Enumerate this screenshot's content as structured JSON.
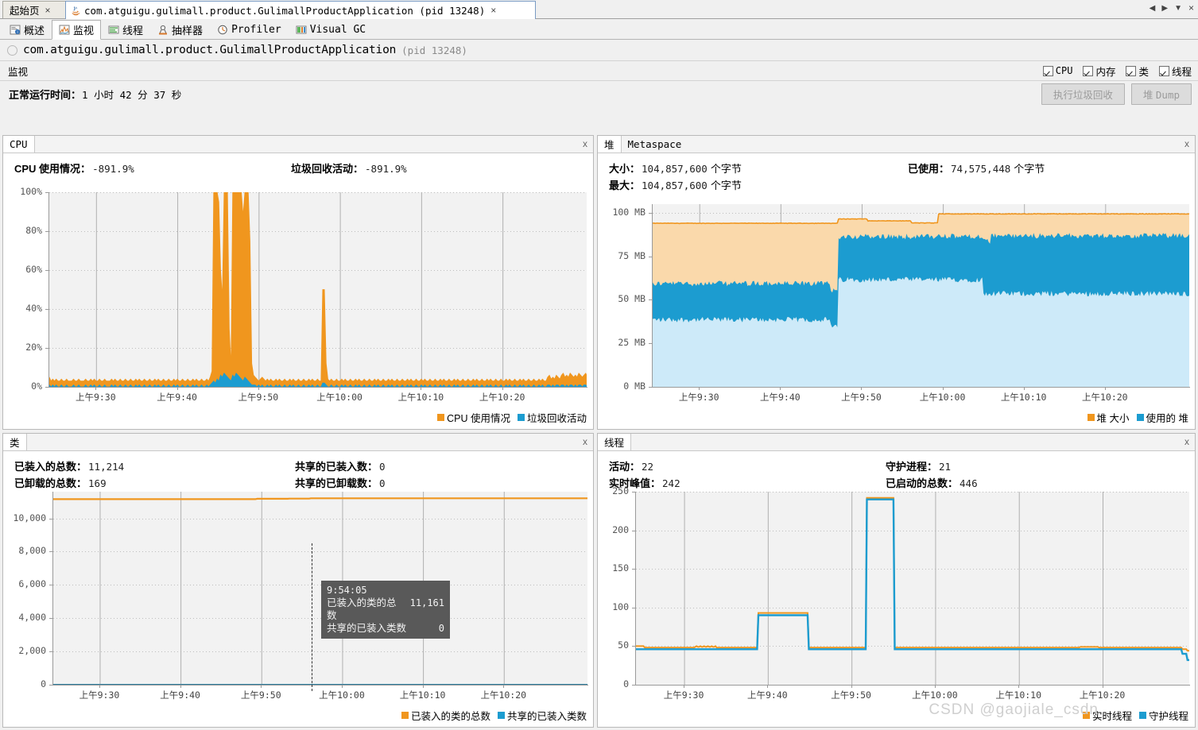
{
  "window": {
    "tabs": [
      {
        "label": "起始页",
        "icon": "none",
        "active": false,
        "close": "×"
      },
      {
        "label": "com.atguigu.gulimall.product.GulimallProductApplication (pid 13248)",
        "icon": "java-icon",
        "active": true,
        "close": "×"
      }
    ],
    "nav": {
      "prev": "◀",
      "next": "▶",
      "down": "▼",
      "close": "×"
    }
  },
  "subtabs": [
    {
      "label": "概述",
      "icon": "overview-icon",
      "active": false
    },
    {
      "label": "监视",
      "icon": "monitor-icon",
      "active": true
    },
    {
      "label": "线程",
      "icon": "threads-icon",
      "active": false
    },
    {
      "label": "抽样器",
      "icon": "sampler-icon",
      "active": false
    },
    {
      "label": "Profiler",
      "icon": "profiler-icon",
      "active": false
    },
    {
      "label": "Visual GC",
      "icon": "visualgc-icon",
      "active": false
    }
  ],
  "app_header": {
    "title": "com.atguigu.gulimall.product.GulimallProductApplication",
    "pid": "(pid 13248)"
  },
  "monitor_bar": {
    "label": "监视",
    "checkboxes": [
      {
        "label": "CPU",
        "checked": true
      },
      {
        "label": "内存",
        "checked": true
      },
      {
        "label": "类",
        "checked": true
      },
      {
        "label": "线程",
        "checked": true
      }
    ]
  },
  "uptime": {
    "label": "正常运行时间：",
    "value": "1 小时 42 分 37 秒"
  },
  "buttons": {
    "gc": "执行垃圾回收",
    "heap_dump_prefix": "堆 ",
    "heap_dump_mono": "Dump"
  },
  "panels": {
    "cpu": {
      "title": "CPU",
      "close": "x",
      "stats": [
        {
          "key": "CPU 使用情况：",
          "value": "-891.9%"
        },
        {
          "key": "垃圾回收活动：",
          "value": "-891.9%"
        }
      ]
    },
    "heap": {
      "tabs": [
        "堆",
        "Metaspace"
      ],
      "selected_tab": "堆",
      "close": "x",
      "stats": [
        {
          "key": "大小：",
          "value": "104,857,600",
          "unit": "个字节"
        },
        {
          "key": "最大：",
          "value": "104,857,600",
          "unit": "个字节"
        },
        {
          "key": "已使用：",
          "value": "74,575,448",
          "unit": "个字节"
        }
      ]
    },
    "classes": {
      "title": "类",
      "close": "x",
      "stats": [
        {
          "key": "已装入的总数：",
          "value": "11,214"
        },
        {
          "key": "已卸载的总数：",
          "value": "169"
        },
        {
          "key": "共享的已装入数：",
          "value": "0"
        },
        {
          "key": "共享的已卸载数：",
          "value": "0"
        }
      ],
      "tooltip": {
        "time": "9:54:05",
        "rows": [
          {
            "label": "已装入的类的总数",
            "value": "11,161"
          },
          {
            "label": "共享的已装入类数",
            "value": "0"
          }
        ]
      }
    },
    "threads": {
      "title": "线程",
      "close": "x",
      "stats": [
        {
          "key": "活动：",
          "value": "22"
        },
        {
          "key": "实时峰值：",
          "value": "242"
        },
        {
          "key": "守护进程：",
          "value": "21"
        },
        {
          "key": "已启动的总数：",
          "value": "446"
        }
      ]
    }
  },
  "watermark": "CSDN @gaojiale_csdn",
  "colors": {
    "orange": "#f0961e",
    "orange_fill": "#fad9ab",
    "blue": "#1c9cd0",
    "blue_fill": "#cdeaf9",
    "plot_bg": "#f2f2f2",
    "grid": "#bdbdbd"
  },
  "chart_data": [
    {
      "id": "cpu",
      "type": "area",
      "title": "CPU",
      "xlabel": "",
      "ylabel": "",
      "ylim": [
        0,
        100
      ],
      "yticks": [
        "0%",
        "20%",
        "40%",
        "60%",
        "80%",
        "100%"
      ],
      "ytick_values": [
        0,
        20,
        40,
        60,
        80,
        100
      ],
      "xticks": [
        "上午9:30",
        "上午9:40",
        "上午9:50",
        "上午10:00",
        "上午10:10",
        "上午10:20"
      ],
      "grid": true,
      "legend_position": "bottom-right",
      "series": [
        {
          "name": "CPU 使用情况",
          "color": "#f0961e",
          "values": [
            5,
            3,
            4,
            3,
            4,
            3,
            3,
            4,
            3,
            3,
            4,
            3,
            3,
            3,
            4,
            3,
            3,
            4,
            3,
            3,
            3,
            4,
            3,
            3,
            4,
            3,
            4,
            3,
            3,
            4,
            3,
            3,
            4,
            3,
            3,
            3,
            4,
            3,
            4,
            3,
            3,
            4,
            3,
            3,
            4,
            3,
            3,
            4,
            3,
            3,
            4,
            3,
            4,
            3,
            3,
            4,
            3,
            3,
            4,
            3,
            3,
            4,
            3,
            4,
            3,
            3,
            4,
            3,
            3,
            4,
            3,
            3,
            4,
            3,
            4,
            3,
            3,
            4,
            3,
            3,
            4,
            3,
            3,
            4,
            3,
            4,
            3,
            3,
            4,
            3,
            3,
            4,
            3,
            5,
            8,
            100,
            100,
            100,
            95,
            60,
            46,
            100,
            100,
            100,
            30,
            10,
            100,
            100,
            100,
            100,
            100,
            100,
            88,
            100,
            100,
            100,
            75,
            12,
            6,
            5,
            4,
            3,
            4,
            5,
            4,
            3,
            4,
            3,
            4,
            3,
            3,
            4,
            3,
            4,
            3,
            3,
            4,
            3,
            3,
            4,
            3,
            4,
            3,
            3,
            4,
            3,
            3,
            4,
            3,
            3,
            4,
            3,
            4,
            3,
            3,
            4,
            3,
            3,
            50,
            50,
            12,
            4,
            3,
            4,
            3,
            3,
            4,
            3,
            3,
            4,
            3,
            4,
            3,
            3,
            4,
            3,
            3,
            4,
            3,
            4,
            3,
            3,
            4,
            3,
            3,
            4,
            3,
            3,
            4,
            3,
            4,
            3,
            3,
            4,
            3,
            3,
            4,
            3,
            4,
            3,
            3,
            4,
            3,
            3,
            4,
            3,
            3,
            4,
            3,
            4,
            3,
            3,
            4,
            3,
            3,
            4,
            3,
            4,
            3,
            3,
            4,
            3,
            3,
            4,
            3,
            3,
            4,
            3,
            4,
            3,
            3,
            4,
            3,
            3,
            4,
            3,
            4,
            3,
            3,
            4,
            3,
            3,
            4,
            3,
            3,
            4,
            3,
            4,
            3,
            3,
            4,
            3,
            3,
            4,
            3,
            4,
            3,
            3,
            4,
            3,
            3,
            4,
            3,
            3,
            4,
            3,
            4,
            3,
            3,
            4,
            3,
            3,
            4,
            3,
            4,
            3,
            3,
            4,
            3,
            3,
            4,
            3,
            3,
            4,
            3,
            4,
            3,
            3,
            5,
            6,
            4,
            5,
            4,
            6,
            5,
            4,
            6,
            7,
            5,
            6,
            5,
            7,
            6,
            5,
            6,
            5,
            7,
            6,
            5,
            6,
            7,
            5
          ]
        },
        {
          "name": "垃圾回收活动",
          "color": "#1c9cd0",
          "values": [
            1,
            0,
            1,
            0,
            1,
            0,
            0,
            1,
            0,
            0,
            1,
            0,
            0,
            0,
            1,
            0,
            0,
            1,
            0,
            0,
            0,
            1,
            0,
            0,
            1,
            0,
            1,
            0,
            0,
            1,
            0,
            0,
            1,
            0,
            0,
            0,
            1,
            0,
            1,
            0,
            0,
            1,
            0,
            0,
            1,
            0,
            0,
            1,
            0,
            0,
            1,
            0,
            1,
            0,
            0,
            1,
            0,
            0,
            1,
            0,
            0,
            1,
            0,
            1,
            0,
            0,
            1,
            0,
            0,
            1,
            0,
            0,
            1,
            0,
            1,
            0,
            0,
            1,
            0,
            0,
            1,
            0,
            0,
            1,
            0,
            1,
            0,
            0,
            1,
            0,
            0,
            1,
            0,
            1,
            2,
            3,
            2,
            4,
            3,
            6,
            5,
            7,
            6,
            5,
            4,
            3,
            6,
            5,
            7,
            6,
            5,
            4,
            3,
            5,
            4,
            3,
            2,
            1,
            1,
            1,
            0,
            1,
            0,
            1,
            0,
            0,
            1,
            0,
            1,
            0,
            0,
            1,
            0,
            1,
            0,
            0,
            1,
            0,
            0,
            1,
            0,
            1,
            0,
            0,
            1,
            0,
            0,
            1,
            0,
            0,
            1,
            0,
            1,
            0,
            0,
            1,
            0,
            0,
            2,
            2,
            1,
            0,
            0,
            1,
            0,
            0,
            1,
            0,
            0,
            1,
            0,
            1,
            0,
            0,
            1,
            0,
            0,
            1,
            0,
            1,
            0,
            0,
            1,
            0,
            0,
            1,
            0,
            0,
            1,
            0,
            1,
            0,
            0,
            1,
            0,
            0,
            1,
            0,
            1,
            0,
            0,
            1,
            0,
            0,
            1,
            0,
            0,
            1,
            0,
            1,
            0,
            0,
            1,
            0,
            0,
            1,
            0,
            1,
            0,
            0,
            1,
            0,
            0,
            1,
            0,
            0,
            1,
            0,
            1,
            0,
            0,
            1,
            0,
            0,
            1,
            0,
            1,
            0,
            0,
            1,
            0,
            0,
            1,
            0,
            0,
            1,
            0,
            1,
            0,
            0,
            1,
            0,
            0,
            1,
            0,
            1,
            0,
            0,
            1,
            0,
            0,
            1,
            0,
            0,
            1,
            0,
            1,
            0,
            0,
            1,
            0,
            0,
            1,
            0,
            1,
            0,
            0,
            1,
            0,
            0,
            1,
            0,
            0,
            1,
            0,
            1,
            0,
            0,
            1,
            1,
            0,
            1,
            0,
            1,
            1,
            0,
            1,
            1,
            0,
            1,
            0,
            1,
            1,
            0,
            1,
            0,
            1,
            1,
            0,
            1,
            1,
            0
          ]
        }
      ]
    },
    {
      "id": "heap",
      "type": "area",
      "title": "堆",
      "ylim": [
        0,
        105
      ],
      "yticks": [
        "0 MB",
        "25 MB",
        "50 MB",
        "75 MB",
        "100 MB"
      ],
      "ytick_values": [
        0,
        25,
        50,
        75,
        100
      ],
      "xticks": [
        "上午9:30",
        "上午9:40",
        "上午9:50",
        "上午10:00",
        "上午10:10",
        "上午10:20"
      ],
      "grid": true,
      "legend_position": "bottom-right",
      "series": [
        {
          "name": "堆 大小",
          "color": "#f0961e",
          "note": "constant near 94-100 MB, steps up after 9:47"
        },
        {
          "name": "使用的 堆",
          "color": "#1c9cd0",
          "note": "sawtooth 36-61 MB before 9:47, 60-88 MB after, 52-88 MB after 10:00"
        }
      ]
    },
    {
      "id": "classes",
      "type": "line",
      "title": "类",
      "ylim": [
        0,
        11600
      ],
      "yticks": [
        "0",
        "2,000",
        "4,000",
        "6,000",
        "8,000",
        "10,000"
      ],
      "ytick_values": [
        0,
        2000,
        4000,
        6000,
        8000,
        10000
      ],
      "xticks": [
        "上午9:30",
        "上午9:40",
        "上午9:50",
        "上午10:00",
        "上午10:10",
        "上午10:20"
      ],
      "grid": true,
      "legend_position": "bottom-right",
      "series": [
        {
          "name": "已装入的类的总数",
          "color": "#f0961e",
          "values": [
            11140,
            11140,
            11142,
            11145,
            11150,
            11155,
            11161,
            11180,
            11200,
            11205,
            11210,
            11214
          ]
        },
        {
          "name": "共享的已装入类数",
          "color": "#1c9cd0",
          "values": [
            0,
            0,
            0,
            0,
            0,
            0,
            0,
            0,
            0,
            0,
            0,
            0
          ]
        }
      ]
    },
    {
      "id": "threads",
      "type": "line",
      "title": "线程",
      "ylim": [
        0,
        250
      ],
      "yticks": [
        "0",
        "50",
        "100",
        "150",
        "200",
        "250"
      ],
      "ytick_values": [
        0,
        50,
        100,
        150,
        200,
        250
      ],
      "xticks": [
        "上午9:30",
        "上午9:40",
        "上午9:50",
        "上午10:00",
        "上午10:10",
        "上午10:20"
      ],
      "grid": true,
      "legend_position": "bottom-right",
      "series": [
        {
          "name": "实时线程",
          "color": "#f0961e",
          "values": [
            49,
            48,
            48,
            48,
            48,
            49,
            49,
            93,
            93,
            48,
            48,
            242,
            242,
            48,
            48,
            48,
            48,
            48,
            48,
            47,
            45
          ]
        },
        {
          "name": "守护线程",
          "color": "#1c9cd0",
          "values": [
            46,
            46,
            46,
            46,
            46,
            46,
            46,
            90,
            90,
            46,
            46,
            240,
            240,
            46,
            46,
            46,
            46,
            46,
            46,
            45,
            32
          ]
        }
      ]
    }
  ],
  "legends": {
    "cpu": [
      {
        "label": "CPU 使用情况",
        "color": "#f0961e"
      },
      {
        "label": "垃圾回收活动",
        "color": "#1c9cd0"
      }
    ],
    "heap": [
      {
        "label": "堆 大小",
        "color": "#f0961e"
      },
      {
        "label": "使用的 堆",
        "color": "#1c9cd0"
      }
    ],
    "classes": [
      {
        "label": "已装入的类的总数",
        "color": "#f0961e"
      },
      {
        "label": "共享的已装入类数",
        "color": "#1c9cd0"
      }
    ],
    "threads": [
      {
        "label": "实时线程",
        "color": "#f0961e"
      },
      {
        "label": "守护线程",
        "color": "#1c9cd0"
      }
    ]
  }
}
